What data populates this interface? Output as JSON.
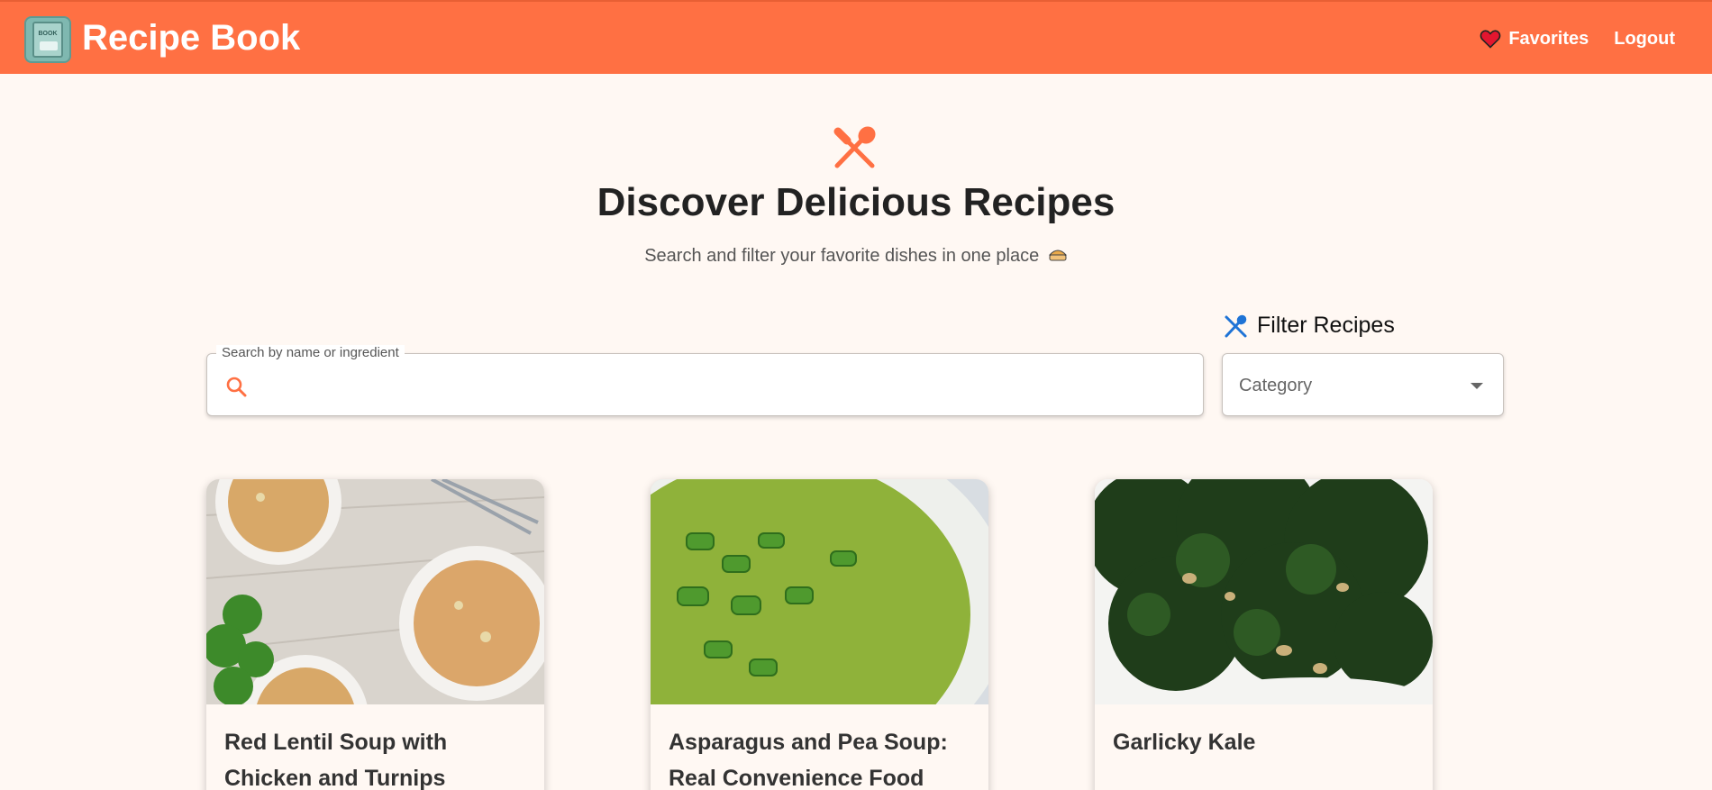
{
  "app": {
    "title": "Recipe Book",
    "logo_text": "BOOK"
  },
  "nav": {
    "favorites_label": "Favorites",
    "logout_label": "Logout"
  },
  "hero": {
    "icon": "utensils-icon",
    "title": "Discover Delicious Recipes",
    "subtitle": "Search and filter your favorite dishes in one place"
  },
  "search": {
    "legend": "Search by name or ingredient",
    "value": "",
    "icon": "search-icon"
  },
  "filter": {
    "heading": "Filter Recipes",
    "category_placeholder": "Category"
  },
  "recipes": [
    {
      "title": "Red Lentil Soup with Chicken and Turnips"
    },
    {
      "title": "Asparagus and Pea Soup: Real Convenience Food"
    },
    {
      "title": "Garlicky Kale"
    }
  ],
  "colors": {
    "brand": "#ff7043",
    "background": "#fff8f3",
    "filter_icon": "#1e73d6"
  }
}
